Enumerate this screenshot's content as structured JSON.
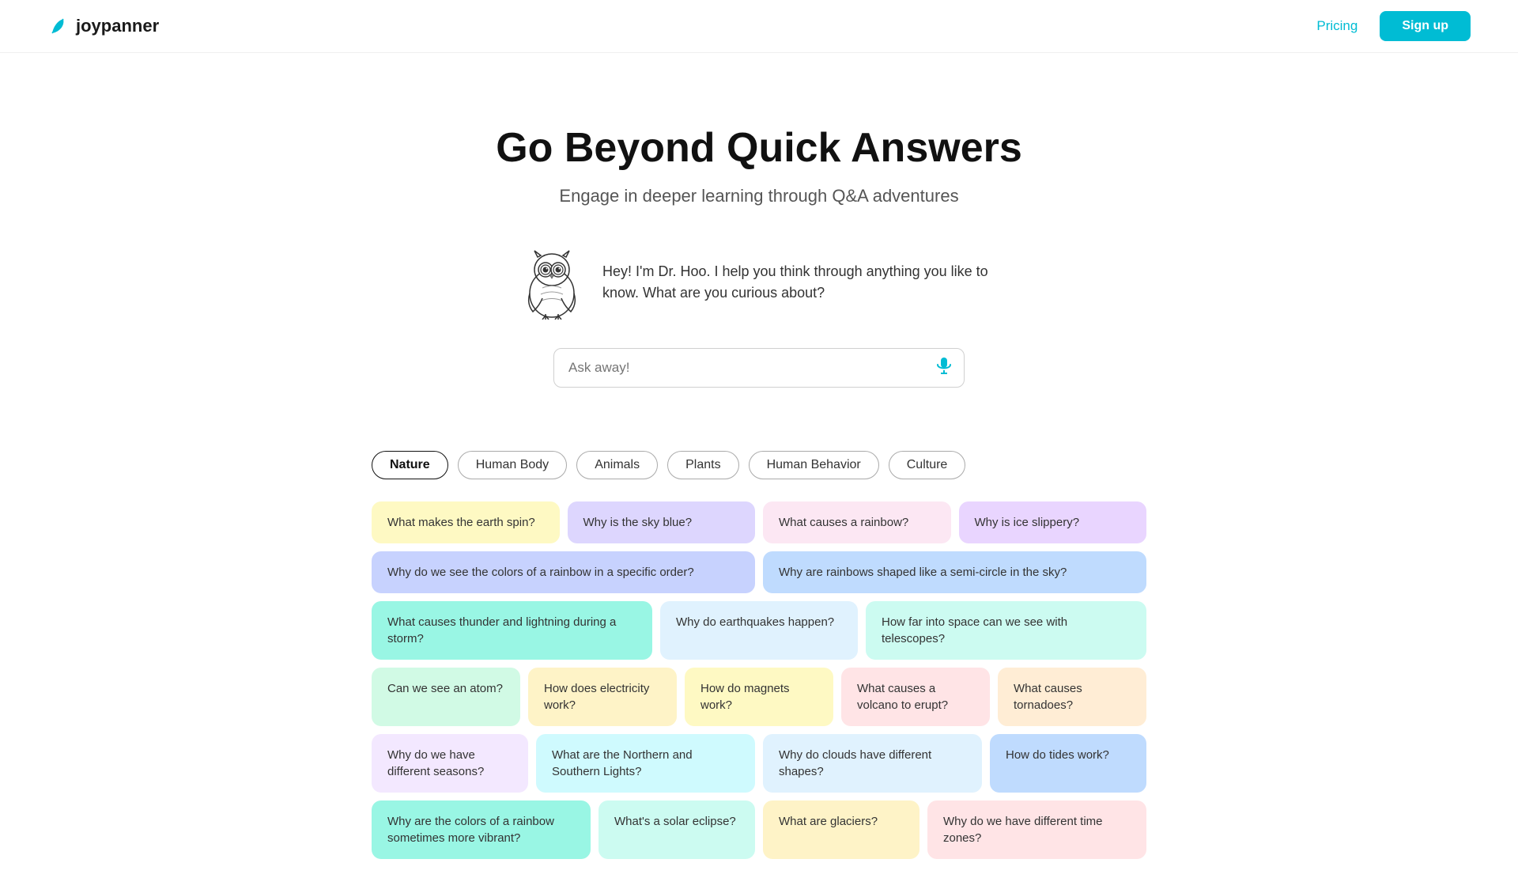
{
  "navbar": {
    "logo_text": "joypanner",
    "pricing_label": "Pricing",
    "signup_label": "Sign up"
  },
  "hero": {
    "title": "Go Beyond Quick Answers",
    "subtitle": "Engage in deeper learning through Q&A adventures"
  },
  "owl_chat": {
    "message": "Hey! I'm Dr. Hoo. I help you think through anything you like to know. What are you curious about?"
  },
  "search": {
    "placeholder": "Ask away!"
  },
  "tabs": [
    {
      "label": "Nature",
      "active": true
    },
    {
      "label": "Human Body",
      "active": false
    },
    {
      "label": "Animals",
      "active": false
    },
    {
      "label": "Plants",
      "active": false
    },
    {
      "label": "Human Behavior",
      "active": false
    },
    {
      "label": "Culture",
      "active": false
    }
  ],
  "cards": [
    [
      {
        "text": "What makes the earth spin?",
        "color": "card-yellow",
        "width": "w1"
      },
      {
        "text": "Why is the sky blue?",
        "color": "card-lavender",
        "width": "w1"
      },
      {
        "text": "What causes a rainbow?",
        "color": "card-pink",
        "width": "w1"
      },
      {
        "text": "Why is ice slippery?",
        "color": "card-purple-light",
        "width": "w1"
      }
    ],
    [
      {
        "text": "Why do we see the colors of a rainbow in a specific order?",
        "color": "card-indigo",
        "width": "w2"
      },
      {
        "text": "Why are rainbows shaped like a semi-circle in the sky?",
        "color": "card-blue",
        "width": "w2"
      }
    ],
    [
      {
        "text": "What causes thunder and lightning during a storm?",
        "color": "card-teal",
        "width": "w15"
      },
      {
        "text": "Why do earthquakes happen?",
        "color": "card-sky",
        "width": "w1"
      },
      {
        "text": "How far into space can we see with telescopes?",
        "color": "card-mint",
        "width": "w15"
      }
    ],
    [
      {
        "text": "Can we see an atom?",
        "color": "card-green-light",
        "width": "w1"
      },
      {
        "text": "How does electricity work?",
        "color": "card-amber",
        "width": "w1"
      },
      {
        "text": "How do magnets work?",
        "color": "card-yellow",
        "width": "w1"
      },
      {
        "text": "What causes a volcano to erupt?",
        "color": "card-rose",
        "width": "w1"
      },
      {
        "text": "What causes tornadoes?",
        "color": "card-peach",
        "width": "w1"
      }
    ],
    [
      {
        "text": "Why do we have different seasons?",
        "color": "card-lilac",
        "width": "w1"
      },
      {
        "text": "What are the Northern and Southern Lights?",
        "color": "card-cyan",
        "width": "w15"
      },
      {
        "text": "Why do clouds have different shapes?",
        "color": "card-sky",
        "width": "w15"
      },
      {
        "text": "How do tides work?",
        "color": "card-blue",
        "width": "w1"
      }
    ],
    [
      {
        "text": "Why are the colors of a rainbow sometimes more vibrant?",
        "color": "card-teal",
        "width": "w15"
      },
      {
        "text": "What's a solar eclipse?",
        "color": "card-mint",
        "width": "w1"
      },
      {
        "text": "What are glaciers?",
        "color": "card-amber",
        "width": "w1"
      },
      {
        "text": "Why do we have different time zones?",
        "color": "card-rose",
        "width": "w15"
      }
    ]
  ]
}
